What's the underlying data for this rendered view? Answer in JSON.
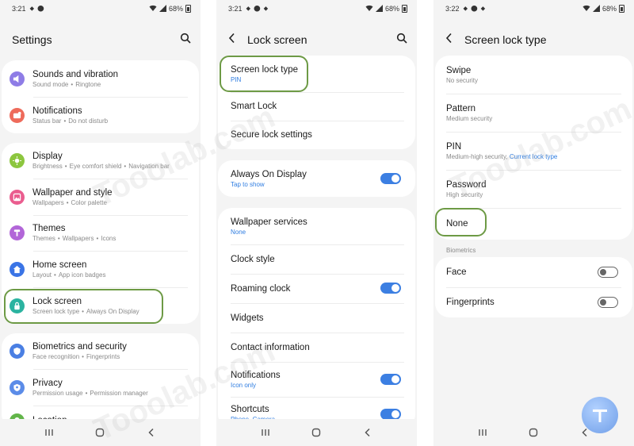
{
  "colors": {
    "accent": "#2f7de1",
    "highlight": "#6d9a45",
    "toggle_on": "#3c7fe2"
  },
  "screen1": {
    "status_time": "3:21",
    "status_battery": "68%",
    "title": "Settings",
    "items": [
      {
        "title": "Sounds and vibration",
        "sub": [
          "Sound mode",
          "Ringtone"
        ],
        "icon": "speaker-icon",
        "color": "#8e7ce6"
      },
      {
        "title": "Notifications",
        "sub": [
          "Status bar",
          "Do not disturb"
        ],
        "icon": "notification-icon",
        "color": "#ee6b5b"
      },
      {
        "title": "Display",
        "sub": [
          "Brightness",
          "Eye comfort shield",
          "Navigation bar"
        ],
        "icon": "sun-icon",
        "color": "#8cc63e"
      },
      {
        "title": "Wallpaper and style",
        "sub": [
          "Wallpapers",
          "Color palette"
        ],
        "icon": "wallpaper-icon",
        "color": "#ea5d8f"
      },
      {
        "title": "Themes",
        "sub": [
          "Themes",
          "Wallpapers",
          "Icons"
        ],
        "icon": "themes-icon",
        "color": "#b266d8"
      },
      {
        "title": "Home screen",
        "sub": [
          "Layout",
          "App icon badges"
        ],
        "icon": "home-icon",
        "color": "#3a74e6"
      },
      {
        "title": "Lock screen",
        "sub": [
          "Screen lock type",
          "Always On Display"
        ],
        "icon": "lock-icon",
        "color": "#2bb3a0"
      },
      {
        "title": "Biometrics and security",
        "sub": [
          "Face recognition",
          "Fingerprints"
        ],
        "icon": "shield-icon",
        "color": "#4a7fe3"
      },
      {
        "title": "Privacy",
        "sub": [
          "Permission usage",
          "Permission manager"
        ],
        "icon": "privacy-icon",
        "color": "#5b8ce8"
      },
      {
        "title": "Location",
        "sub": [],
        "icon": "location-icon",
        "color": "#62b549"
      }
    ]
  },
  "screen2": {
    "status_time": "3:21",
    "status_battery": "68%",
    "title": "Lock screen",
    "items": [
      {
        "title": "Screen lock type",
        "sub": "PIN",
        "toggle": null
      },
      {
        "title": "Smart Lock",
        "sub": "",
        "toggle": null
      },
      {
        "title": "Secure lock settings",
        "sub": "",
        "toggle": null
      },
      {
        "title": "Always On Display",
        "sub": "Tap to show",
        "toggle": "on"
      },
      {
        "title": "Wallpaper services",
        "sub": "None",
        "toggle": null
      },
      {
        "title": "Clock style",
        "sub": "",
        "toggle": null
      },
      {
        "title": "Roaming clock",
        "sub": "",
        "toggle": "on"
      },
      {
        "title": "Widgets",
        "sub": "",
        "toggle": null
      },
      {
        "title": "Contact information",
        "sub": "",
        "toggle": null
      },
      {
        "title": "Notifications",
        "sub": "Icon only",
        "toggle": "on"
      },
      {
        "title": "Shortcuts",
        "sub": "Phone, Camera",
        "toggle": "on"
      }
    ]
  },
  "screen3": {
    "status_time": "3:22",
    "status_battery": "68%",
    "title": "Screen lock type",
    "items": [
      {
        "title": "Swipe",
        "sub": "No security"
      },
      {
        "title": "Pattern",
        "sub": "Medium security"
      },
      {
        "title": "PIN",
        "sub": "Medium-high security,",
        "sub_extra": "Current lock type"
      },
      {
        "title": "Password",
        "sub": "High security"
      },
      {
        "title": "None",
        "sub": ""
      }
    ],
    "biometrics_label": "Biometrics",
    "biometrics": [
      {
        "title": "Face",
        "toggle": "off"
      },
      {
        "title": "Fingerprints",
        "toggle": "off"
      }
    ]
  },
  "watermark": "Tooolab.com"
}
